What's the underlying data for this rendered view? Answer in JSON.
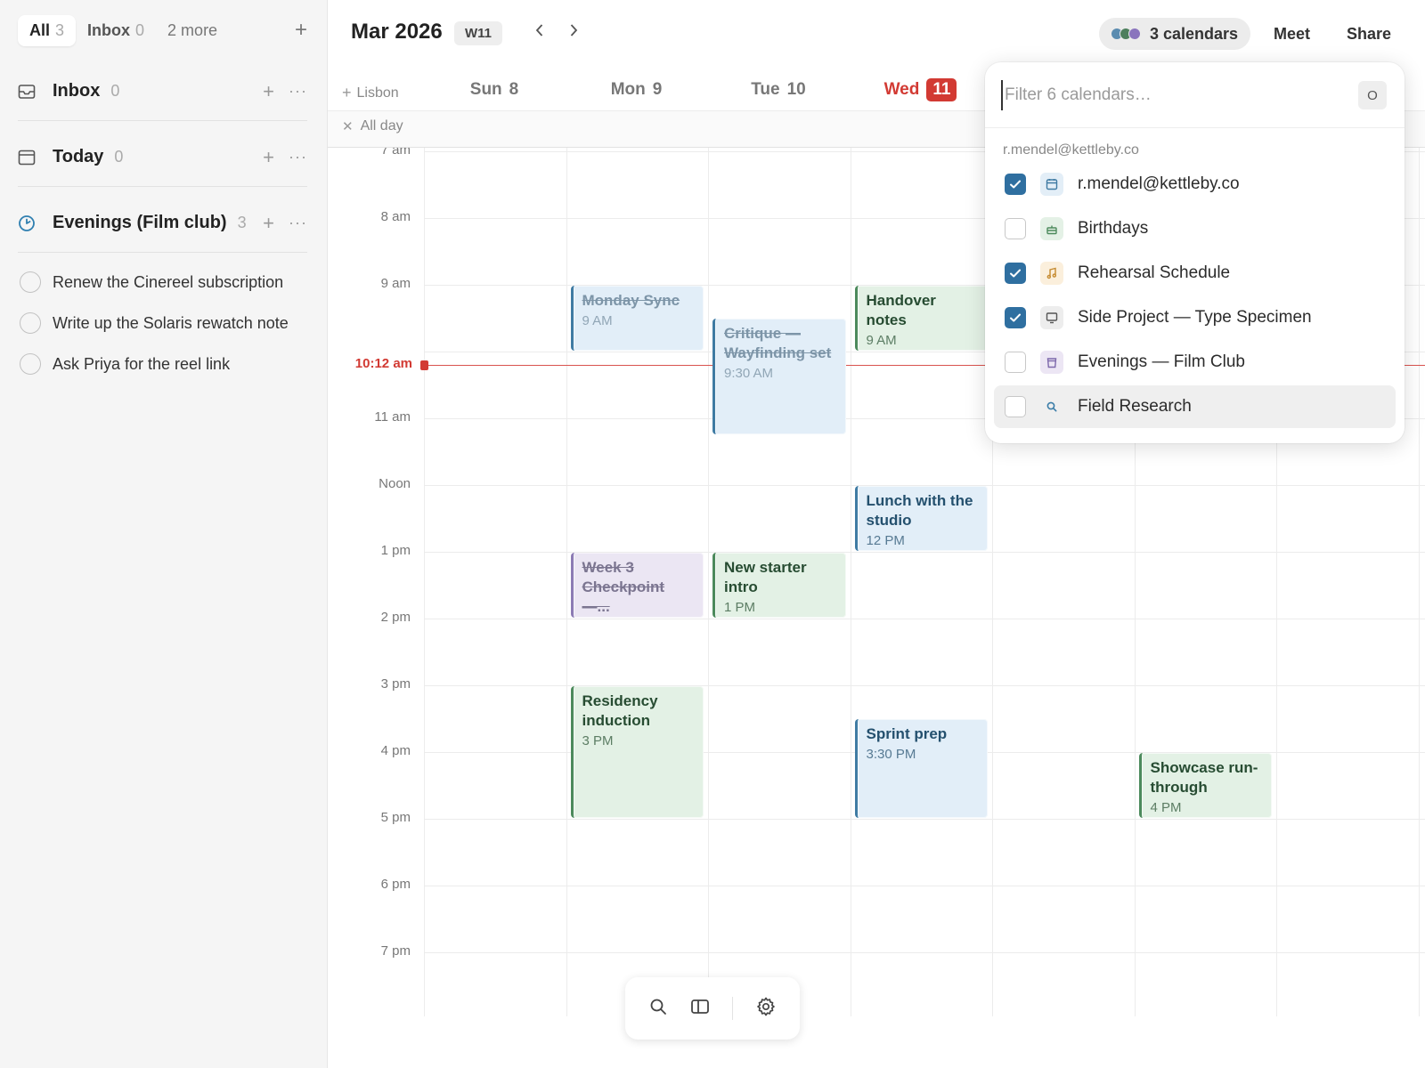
{
  "sidebar": {
    "tabs": [
      {
        "label": "All",
        "count": "3"
      },
      {
        "label": "Inbox",
        "count": "0"
      },
      {
        "label": "2 more"
      }
    ],
    "sections": [
      {
        "title": "Inbox",
        "count": "0",
        "icon": "inbox-icon"
      },
      {
        "title": "Today",
        "count": "0",
        "icon": "calendar-icon"
      },
      {
        "title": "Evenings (Film club)",
        "count": "3",
        "icon": "progress-circle-icon"
      }
    ],
    "tasks": [
      "Renew the Cinereel subscription",
      "Write up the Solaris rewatch note",
      "Ask Priya for the reel link"
    ]
  },
  "header": {
    "month": "Mar 2026",
    "week": "W11",
    "calendars_label": "3 calendars",
    "meet": "Meet",
    "share": "Share",
    "dot_colors": [
      "#5b8cb0",
      "#4d7f5d",
      "#8a74bd"
    ]
  },
  "calendar": {
    "timezone": "Lisbon",
    "all_day": "All day",
    "days": [
      {
        "name": "Sun",
        "num": "8"
      },
      {
        "name": "Mon",
        "num": "9"
      },
      {
        "name": "Tue",
        "num": "10"
      },
      {
        "name": "Wed",
        "num": "11",
        "today": true
      }
    ],
    "hours": [
      "7 am",
      "8 am",
      "9 am",
      "10 am",
      "11 am",
      "Noon",
      "1 pm",
      "2 pm",
      "3 pm",
      "4 pm",
      "5 pm",
      "6 pm",
      "7 pm"
    ],
    "now_label": "10:12 am",
    "now_hour": 10.2,
    "events": [
      {
        "title": "Monday Sync",
        "time": "9 AM",
        "day": 1,
        "start": 9,
        "end": 10,
        "color": "blue",
        "done": true
      },
      {
        "title": "Critique — Wayfinding set",
        "time": "9:30 AM",
        "day": 2,
        "start": 9.5,
        "end": 11.25,
        "color": "blue",
        "done": true
      },
      {
        "title": "Handover notes",
        "time": "9 AM",
        "day": 3,
        "start": 9,
        "end": 10,
        "color": "green",
        "done": false
      },
      {
        "title": "Lunch with the studio",
        "time": "12 PM",
        "day": 3,
        "start": 12,
        "end": 13,
        "color": "blue",
        "done": false
      },
      {
        "title": "Week 3 Checkpoint —...",
        "time": "1 PM",
        "day": 1,
        "start": 13,
        "end": 14,
        "color": "purple",
        "done": true
      },
      {
        "title": "New starter intro",
        "time": "1 PM",
        "day": 2,
        "start": 13,
        "end": 14,
        "color": "green",
        "done": false
      },
      {
        "title": "Residency induction",
        "time": "3 PM",
        "day": 1,
        "start": 15,
        "end": 17,
        "color": "green",
        "done": false
      },
      {
        "title": "Sprint prep",
        "time": "3:30 PM",
        "day": 3,
        "start": 15.5,
        "end": 17,
        "color": "blue",
        "done": false
      },
      {
        "title": "Showcase run-through",
        "time": "4 PM",
        "day": 5,
        "start": 16,
        "end": 17,
        "color": "green",
        "done": false
      }
    ]
  },
  "popover": {
    "placeholder": "Filter 6 calendars…",
    "shortcut": "O",
    "account": "r.mendel@kettleby.co",
    "calendars": [
      {
        "name": "r.mendel@kettleby.co",
        "checked": true,
        "icon": "calendar-icon",
        "bg": "#e3eef7",
        "fg": "#3f7ba3"
      },
      {
        "name": "Birthdays",
        "checked": false,
        "icon": "cake-icon",
        "bg": "#e4f1e6",
        "fg": "#4c8a5c"
      },
      {
        "name": "Rehearsal Schedule",
        "checked": true,
        "icon": "music-note-icon",
        "bg": "#fbefdc",
        "fg": "#c58a2f"
      },
      {
        "name": "Side Project — Type Specimen",
        "checked": true,
        "icon": "monitor-icon",
        "bg": "#ededed",
        "fg": "#555555"
      },
      {
        "name": "Evenings — Film Club",
        "checked": false,
        "icon": "film-icon",
        "bg": "#ece6f4",
        "fg": "#7d68ab"
      },
      {
        "name": "Field Research",
        "checked": false,
        "icon": "search-icon",
        "bg": "transparent",
        "fg": "#3b7da8",
        "hover": true
      }
    ]
  }
}
